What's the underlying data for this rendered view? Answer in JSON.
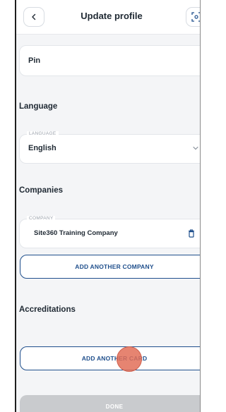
{
  "header": {
    "title": "Update profile",
    "back_icon": "chevron-left-icon",
    "scan_icon": "scan-icon"
  },
  "pin": {
    "value": "Pin"
  },
  "language_section": {
    "title": "Language",
    "field_legend": "LANGUAGE",
    "selected": "English"
  },
  "companies_section": {
    "title": "Companies",
    "field_legend": "COMPANY",
    "company": "Site360 Training Company",
    "add_button": "ADD ANOTHER COMPANY"
  },
  "accreditations_section": {
    "title": "Accreditations",
    "add_button": "ADD ANOTHER CARD"
  },
  "done_button": "DONE",
  "colors": {
    "accent": "#1f4f8c",
    "touch_indicator": "#e26e58",
    "disabled_button": "#c9cbce"
  }
}
